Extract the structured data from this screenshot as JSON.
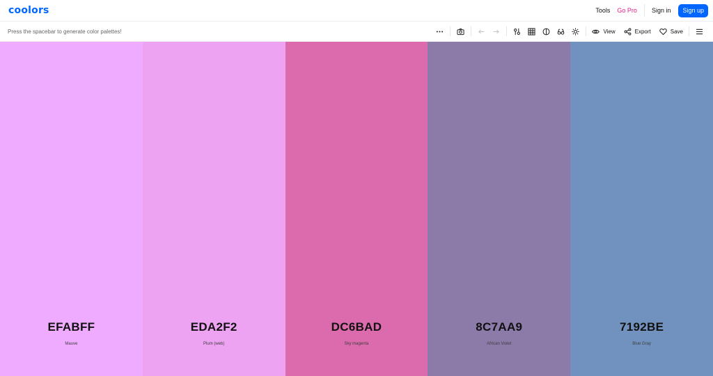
{
  "header": {
    "logo": "coolors",
    "tools": "Tools",
    "go_pro": "Go Pro",
    "sign_in": "Sign in",
    "sign_up": "Sign up"
  },
  "toolbar": {
    "hint": "Press the spacebar to generate color palettes!",
    "view_label": "View",
    "export_label": "Export",
    "save_label": "Save",
    "icons": [
      "more-options-icon",
      "camera-icon",
      "undo-icon",
      "redo-icon",
      "adjust-palette-icon",
      "grid-icon",
      "contrast-icon",
      "visualize-icon",
      "quick-view-icon",
      "eye-icon",
      "share-icon",
      "heart-icon",
      "menu-icon"
    ]
  },
  "palette": {
    "colors": [
      {
        "hex": "EFABFF",
        "name": "Mauve",
        "color": "#efabff"
      },
      {
        "hex": "EDA2F2",
        "name": "Plum (web)",
        "color": "#eda2f2"
      },
      {
        "hex": "DC6BAD",
        "name": "Sky magenta",
        "color": "#dc6bad"
      },
      {
        "hex": "8C7AA9",
        "name": "African Violet",
        "color": "#8c7aa9"
      },
      {
        "hex": "7192BE",
        "name": "Blue Gray",
        "color": "#7192be"
      }
    ]
  },
  "colors": {
    "brand": "#0066ff",
    "pro": "#e91e8c"
  }
}
